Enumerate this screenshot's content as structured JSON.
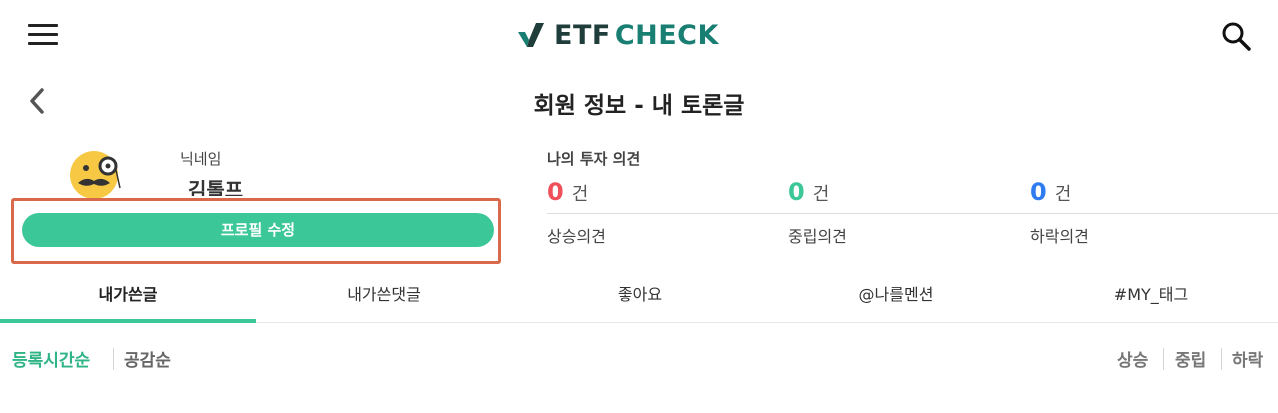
{
  "header": {
    "logo_etf": "ETF",
    "logo_check": "CHECK",
    "menu_icon": "hamburger-menu-icon",
    "search_icon": "search-icon",
    "brand_dark": "#1f3d3a",
    "brand_teal": "#1a7f73"
  },
  "page": {
    "title": "회원 정보 - 내 토론글",
    "back_icon": "chevron-left-icon"
  },
  "profile": {
    "nickname_label": "닉네임",
    "nickname": "김톨프",
    "avatar_icon": "monocle-mustache-face-icon",
    "edit_button": "프로필 수정",
    "accent_color": "#3cc799"
  },
  "opinions": {
    "title": "나의 투자 의견",
    "items": [
      {
        "count": "0",
        "unit": "건",
        "label": "상승의견",
        "color": "#f0505a"
      },
      {
        "count": "0",
        "unit": "건",
        "label": "중립의견",
        "color": "#3cc799"
      },
      {
        "count": "0",
        "unit": "건",
        "label": "하락의견",
        "color": "#2f7bf0"
      }
    ]
  },
  "tabs": [
    {
      "label": "내가쓴글",
      "active": true
    },
    {
      "label": "내가쓴댓글",
      "active": false
    },
    {
      "label": "좋아요",
      "active": false
    },
    {
      "label": "@나를멘션",
      "active": false
    },
    {
      "label": "#MY_태그",
      "active": false
    }
  ],
  "sort": [
    {
      "label": "등록시간순",
      "active": true
    },
    {
      "label": "공감순",
      "active": false
    }
  ],
  "filters": [
    "상승",
    "중립",
    "하락"
  ]
}
